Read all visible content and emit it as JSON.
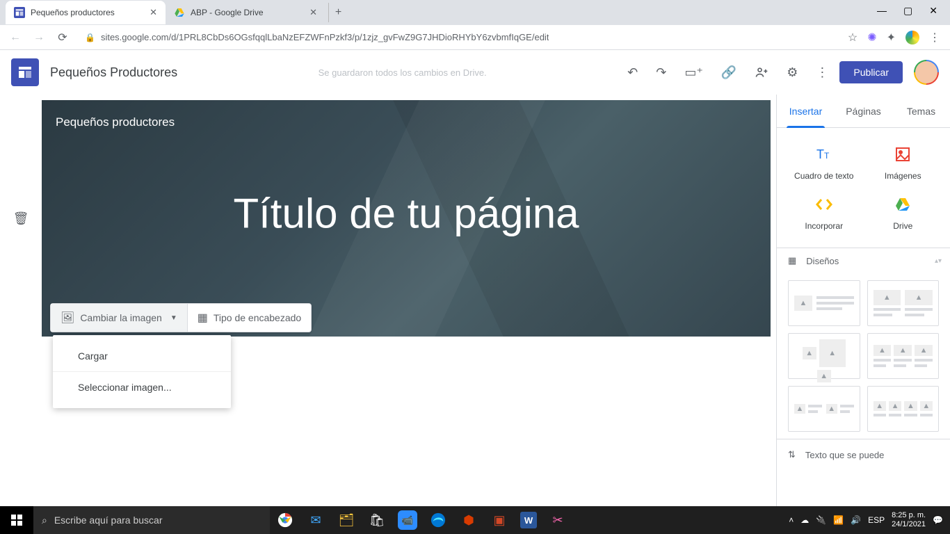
{
  "window": {
    "minimize": "—",
    "maximize": "▢",
    "close": "✕"
  },
  "browser": {
    "tabs": [
      {
        "title": "Pequeños productores",
        "active": true
      },
      {
        "title": "ABP - Google Drive",
        "active": false
      }
    ],
    "url": "sites.google.com/d/1PRL8CbDs6OGsfqqlLbaNzEFZWFnPzkf3/p/1zjz_gvFwZ9G7JHDioRHYbY6zvbmfIqGE/edit"
  },
  "app": {
    "doc_title": "Pequeños Productores",
    "save_status": "Se guardaron todos los cambios en Drive.",
    "publish": "Publicar"
  },
  "page": {
    "site_name": "Pequeños productores",
    "title": "Título de tu página",
    "tools": {
      "change_image": "Cambiar la imagen",
      "header_type": "Tipo de encabezado"
    },
    "dropdown": {
      "upload": "Cargar",
      "select": "Seleccionar imagen..."
    }
  },
  "sidebar": {
    "tabs": {
      "insert": "Insertar",
      "pages": "Páginas",
      "themes": "Temas"
    },
    "insert": {
      "textbox": "Cuadro de texto",
      "images": "Imágenes",
      "embed": "Incorporar",
      "drive": "Drive"
    },
    "layouts_label": "Diseños",
    "collapsible": "Texto que se puede"
  },
  "taskbar": {
    "search_placeholder": "Escribe aquí para buscar",
    "lang": "ESP",
    "time": "8:25 p. m.",
    "date": "24/1/2021"
  }
}
